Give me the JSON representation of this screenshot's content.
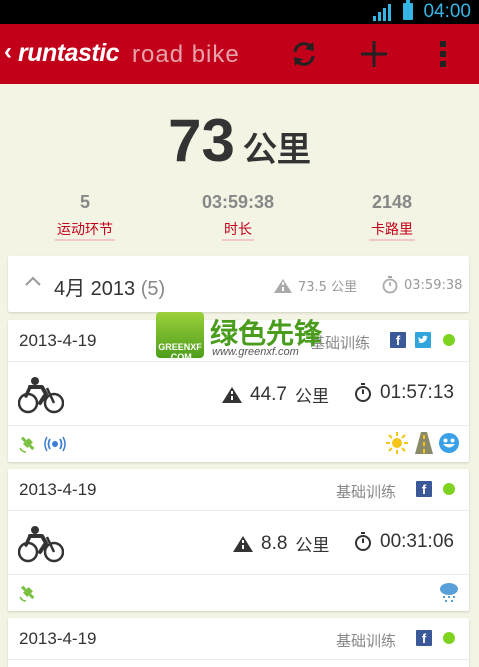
{
  "status_bar": {
    "time": "04:00",
    "accent": "#33b5e5"
  },
  "action_bar": {
    "back_glyph": "‹",
    "brand": "runtastic",
    "subtitle": "road bike",
    "color": "#c2001a",
    "icons": [
      "refresh-icon",
      "add-icon",
      "overflow-menu-icon"
    ]
  },
  "summary": {
    "total_value": "73",
    "total_unit": "公里",
    "stats": [
      {
        "value": "5",
        "label": "运动环节"
      },
      {
        "value": "03:59:38",
        "label": "时长"
      },
      {
        "value": "2148",
        "label": "卡路里"
      }
    ]
  },
  "month_group": {
    "label": "4月 2013",
    "count": "(5)",
    "distance": "73.5 公里",
    "duration": "03:59:38"
  },
  "sessions": [
    {
      "date": "2013-4-19",
      "type": "基础训练",
      "distance": "44.7",
      "distance_unit": "公里",
      "duration": "01:57:13",
      "share": [
        "facebook-icon",
        "twitter-icon"
      ],
      "icons_left": [
        "gps-icon",
        "heart-rate-sensor-icon"
      ],
      "icons_right": [
        "sunny-icon",
        "road-icon",
        "happy-face-icon"
      ]
    },
    {
      "date": "2013-4-19",
      "type": "基础训练",
      "distance": "8.8",
      "distance_unit": "公里",
      "duration": "00:31:06",
      "share": [
        "facebook-icon"
      ],
      "icons_left": [
        "gps-icon"
      ],
      "icons_right": [
        "rain-cloud-icon"
      ]
    },
    {
      "date": "2013-4-19",
      "type": "基础训练",
      "share": [
        "facebook-icon"
      ]
    }
  ],
  "watermark": {
    "logo_text": "GREENXF .COM",
    "name": "绿色先锋",
    "url": "www.greenxf.com"
  }
}
